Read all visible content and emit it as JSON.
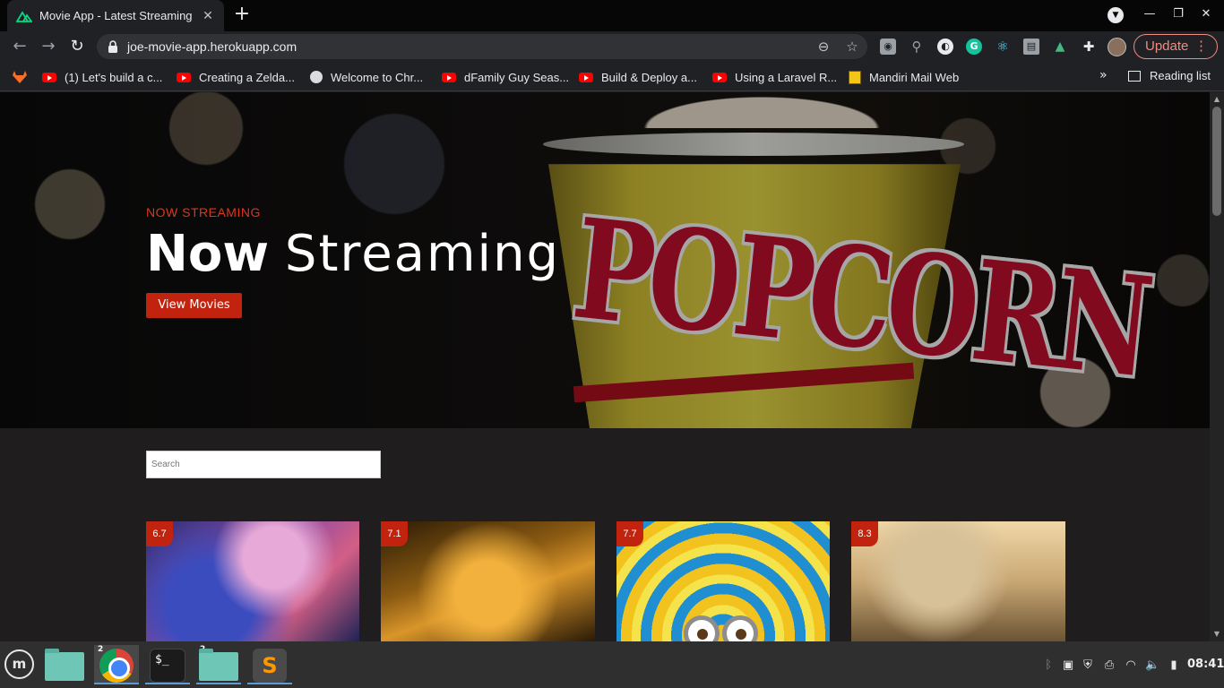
{
  "browser": {
    "tab_title": "Movie App - Latest Streaming",
    "tab_close": "✕",
    "new_tab": "+",
    "url": "joe-movie-app.herokuapp.com",
    "update_label": "Update",
    "reading_list": "Reading list",
    "bookmarks": [
      {
        "label": "(1) Let's build a c...",
        "icon": "youtube-icon"
      },
      {
        "label": "Creating a Zelda...",
        "icon": "youtube-icon"
      },
      {
        "label": "Welcome to Chr...",
        "icon": "globe-icon"
      },
      {
        "label": "dFamily Guy Seas...",
        "icon": "youtube-icon"
      },
      {
        "label": "Build & Deploy a...",
        "icon": "youtube-icon"
      },
      {
        "label": "Using a Laravel R...",
        "icon": "youtube-icon"
      },
      {
        "label": "Mandiri Mail Web",
        "icon": "mail-icon"
      }
    ]
  },
  "hero": {
    "kicker": "NOW STREAMING",
    "title_bold": "Now",
    "title_light": "Streaming",
    "button_label": "View Movies",
    "background_text": "POPCORN"
  },
  "search": {
    "placeholder": "Search"
  },
  "movies": [
    {
      "rating": "6.7"
    },
    {
      "rating": "7.1"
    },
    {
      "rating": "7.7"
    },
    {
      "rating": "8.3"
    }
  ],
  "taskbar": {
    "clock": "08:41",
    "chrome_badge": "2",
    "files_badge": "2",
    "terminal_prompt": "$_",
    "sublime_letter": "S"
  },
  "colors": {
    "accent": "#c1230f",
    "kicker": "#d9381e",
    "update": "#f28b82",
    "page_bg": "#1f1d1e"
  }
}
